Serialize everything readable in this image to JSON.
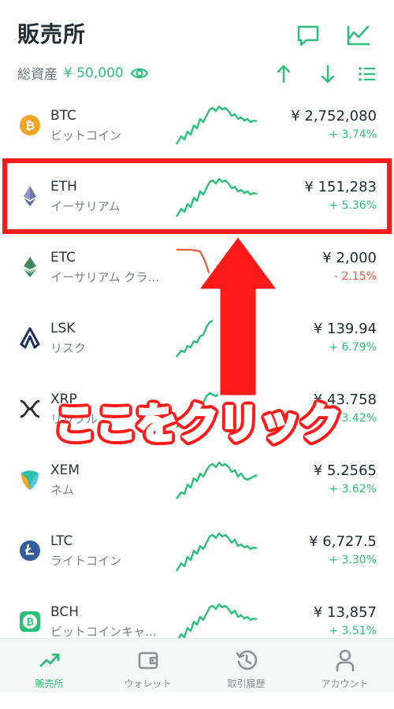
{
  "header": {
    "title": "販売所",
    "total_assets_label": "総資産",
    "total_assets_value": "¥ 50,000"
  },
  "colors": {
    "accent": "#2bbf7a",
    "negative": "#e65a3c",
    "highlight": "#ff1a1a"
  },
  "coins": [
    {
      "symbol": "BTC",
      "name": "ビットコイン",
      "price": "¥ 2,752,080",
      "change": "+ 3.74%",
      "trend": "up",
      "icon": "bitcoin-icon",
      "color": "#f3a521"
    },
    {
      "symbol": "ETH",
      "name": "イーサリアム",
      "price": "¥ 151,283",
      "change": "+ 5.36%",
      "trend": "up",
      "icon": "ethereum-icon",
      "color": "#5f6ea0"
    },
    {
      "symbol": "ETC",
      "name": "イーサリアム クラ…",
      "price": "¥ 2,000",
      "change": "- 2.15%",
      "trend": "down",
      "icon": "ethereum-classic-icon",
      "color": "#3c8a5a"
    },
    {
      "symbol": "LSK",
      "name": "リスク",
      "price": "¥ 139.94",
      "change": "+ 6.79%",
      "trend": "up",
      "icon": "lisk-icon",
      "color": "#1a2f5a"
    },
    {
      "symbol": "XRP",
      "name": "リップル",
      "price": "¥ 43.758",
      "change": "+ 3.42%",
      "trend": "up",
      "icon": "ripple-icon",
      "color": "#23292f"
    },
    {
      "symbol": "XEM",
      "name": "ネム",
      "price": "¥ 5.2565",
      "change": "+ 3.62%",
      "trend": "up",
      "icon": "nem-icon",
      "color": "#2fbfb0"
    },
    {
      "symbol": "LTC",
      "name": "ライトコイン",
      "price": "¥ 6,727.5",
      "change": "+ 3.30%",
      "trend": "up",
      "icon": "litecoin-icon",
      "color": "#345d9d"
    },
    {
      "symbol": "BCH",
      "name": "ビットコインキャ…",
      "price": "¥ 13,857",
      "change": "+ 3.51%",
      "trend": "up",
      "icon": "bitcoin-cash-icon",
      "color": "#2bbf7a"
    }
  ],
  "callout": "ここをクリック",
  "tabs": [
    {
      "label": "販売所",
      "icon": "chart-trend-icon",
      "active": true
    },
    {
      "label": "ウォレット",
      "icon": "wallet-icon",
      "active": false
    },
    {
      "label": "取引履歴",
      "icon": "history-icon",
      "active": false
    },
    {
      "label": "アカウント",
      "icon": "account-icon",
      "active": false
    }
  ]
}
